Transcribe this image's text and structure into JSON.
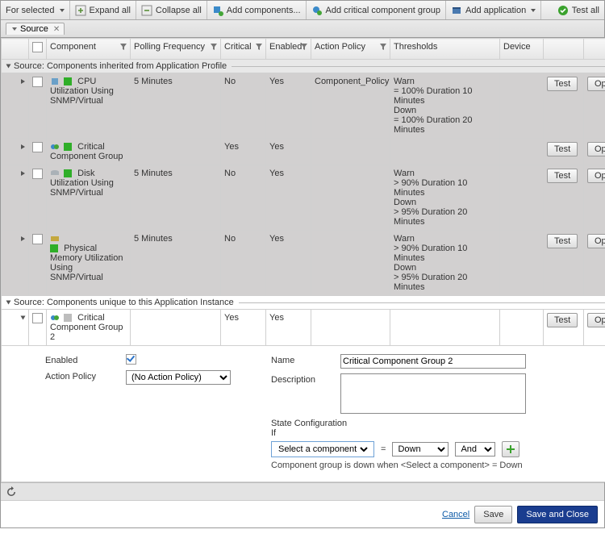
{
  "toolbar": {
    "for_selected": "For selected",
    "expand_all": "Expand all",
    "collapse_all": "Collapse all",
    "add_components": "Add components...",
    "add_group": "Add critical component group",
    "add_app": "Add application",
    "test_all": "Test all"
  },
  "tab": {
    "label": "Source",
    "close": "✕"
  },
  "headers": {
    "component": "Component",
    "polling": "Polling Frequency",
    "critical": "Critical",
    "enabled": "Enabled",
    "action_policy": "Action Policy",
    "thresholds": "Thresholds",
    "device": "Device"
  },
  "groups": {
    "inherited": "Source: Components inherited from Application Profile",
    "unique": "Source: Components unique to this Application Instance"
  },
  "rows": [
    {
      "name": "CPU Utilization Using SNMP/Virtual",
      "poll": "5 Minutes",
      "crit": "No",
      "en": "Yes",
      "ap": "Component_Policy",
      "th": "Warn\n= 100% Duration 10 Minutes\nDown\n= 100% Duration 20 Minutes"
    },
    {
      "name": "Critical Component Group",
      "poll": "",
      "crit": "Yes",
      "en": "Yes",
      "ap": "",
      "th": ""
    },
    {
      "name": "Disk Utilization Using SNMP/Virtual",
      "poll": "5 Minutes",
      "crit": "No",
      "en": "Yes",
      "ap": "",
      "th": "Warn\n> 90% Duration 10 Minutes\nDown\n> 95% Duration 20 Minutes"
    },
    {
      "name": "Physical Memory Utilization Using SNMP/Virtual",
      "poll": "5 Minutes",
      "crit": "No",
      "en": "Yes",
      "ap": "",
      "th": "Warn\n> 90% Duration 10 Minutes\nDown\n> 95% Duration 20 Minutes"
    }
  ],
  "unique_row": {
    "name": "Critical Component Group 2",
    "crit": "Yes",
    "en": "Yes"
  },
  "buttons": {
    "test": "Test",
    "options": "Options"
  },
  "detail": {
    "enabled_label": "Enabled",
    "action_policy_label": "Action Policy",
    "action_policy_value": "(No Action Policy)",
    "name_label": "Name",
    "name_value": "Critical Component Group 2",
    "desc_label": "Description",
    "desc_value": "",
    "state_label": "State Configuration",
    "if_label": "If",
    "select_comp": "Select a component",
    "equals": "=",
    "down_opt": "Down",
    "and_opt": "And",
    "hint": "Component group is down when <Select a component> = Down"
  },
  "footer": {
    "cancel": "Cancel",
    "save": "Save",
    "save_close": "Save and Close"
  }
}
